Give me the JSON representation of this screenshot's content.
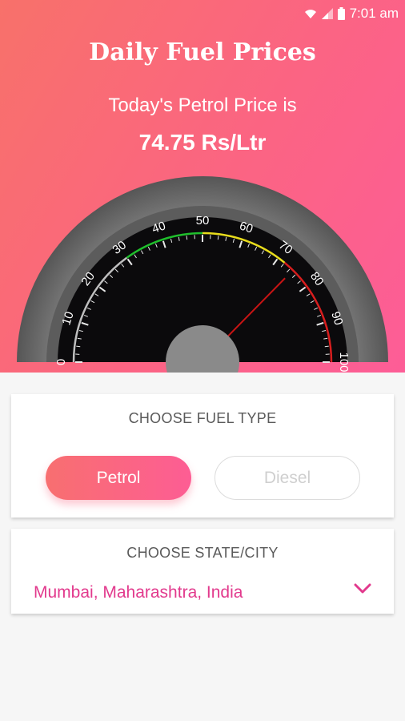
{
  "status": {
    "time": "7:01 am"
  },
  "header": {
    "title": "Daily Fuel Prices",
    "subtitle": "Today's Petrol Price is",
    "price": "74.75 Rs/Ltr"
  },
  "gauge": {
    "min": 0,
    "max": 100,
    "value": 74.75,
    "tick_labels": [
      "0",
      "10",
      "20",
      "30",
      "40",
      "50",
      "60",
      "70",
      "80",
      "90",
      "100"
    ],
    "colors": {
      "green": "#1fbf2c",
      "yellow": "#e8dc1c",
      "red": "#d81e1e",
      "dial": "#0b0a0c"
    }
  },
  "fuel_card": {
    "title": "CHOOSE FUEL TYPE",
    "options": [
      "Petrol",
      "Diesel"
    ],
    "selected": "Petrol"
  },
  "city_card": {
    "title": "CHOOSE STATE/CITY",
    "selected_city": "Mumbai, Maharashtra, India"
  },
  "colors": {
    "accent": "#fd5d94",
    "accent_start": "#f86f70",
    "city_text": "#e23a8d"
  }
}
